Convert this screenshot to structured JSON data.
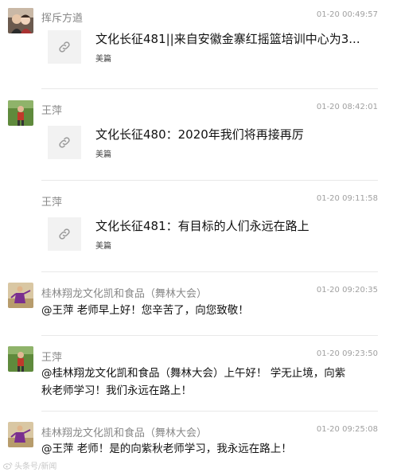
{
  "messages": [
    {
      "sender": "挥斥方遒",
      "time": "01-20 00:49:57",
      "avatar": "avatar-portrait-icon",
      "card": {
        "title": "文化长征481||来自安徽金寨红摇篮培训中心为3...",
        "source": "美篇"
      }
    },
    {
      "sender": "王萍",
      "time": "01-20 08:42:01",
      "avatar": "avatar-outdoor-icon",
      "card": {
        "title": "文化长征480：2020年我们将再接再厉",
        "source": "美篇"
      }
    },
    {
      "sender": "王萍",
      "time": "01-20 09:11:58",
      "avatar": "",
      "card": {
        "title": "文化长征481：有目标的人们永远在路上",
        "source": "美篇"
      }
    },
    {
      "sender": "桂林翔龙文化凯和食品（舞林大会）",
      "time": "01-20 09:20:35",
      "avatar": "avatar-dancer-icon",
      "text": "@王萍 老师早上好！您辛苦了，向您致敬！"
    },
    {
      "sender": "王萍",
      "time": "01-20 09:23:50",
      "avatar": "avatar-outdoor-icon",
      "text_lines": [
        "@桂林翔龙文化凯和食品（舞林大会）上午好！ 学无止境，向紫",
        "秋老师学习！我们永远在路上！"
      ]
    },
    {
      "sender": "桂林翔龙文化凯和食品（舞林大会）",
      "time": "01-20 09:25:08",
      "avatar": "avatar-dancer-icon",
      "text": "@王萍 老师！是的向紫秋老师学习，我永远在路上！"
    }
  ],
  "icons": {
    "card_thumb": "link-icon",
    "watermark": "weibo-icon"
  },
  "watermark": "头条号/新闻"
}
